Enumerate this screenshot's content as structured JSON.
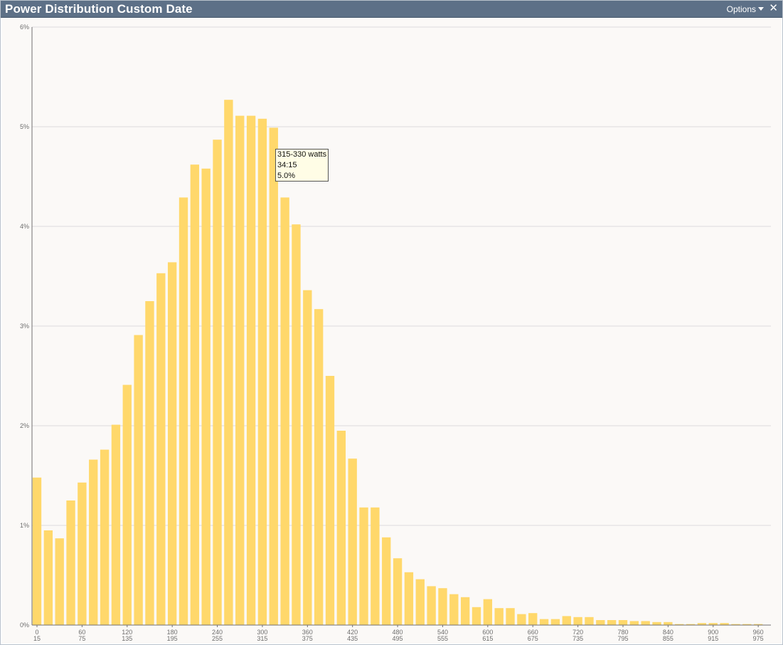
{
  "window": {
    "title": "Power Distribution Custom Date",
    "options_label": "Options",
    "close_symbol": "✕",
    "icons": {
      "options": "chevron-down-icon",
      "close": "close-icon"
    }
  },
  "colors": {
    "bar": "#ffd86b",
    "grid": "#dcdcdc",
    "axis": "#707070",
    "titlebar": "#5d7087",
    "background": "#fbf9f7"
  },
  "chart_data": {
    "type": "bar",
    "title": "Power Distribution Custom Date",
    "xlabel": "",
    "ylabel": "",
    "bin_width": 15,
    "bin_starts": [
      0,
      15,
      30,
      45,
      60,
      75,
      90,
      105,
      120,
      135,
      150,
      165,
      180,
      195,
      210,
      225,
      240,
      255,
      270,
      285,
      300,
      315,
      330,
      345,
      360,
      375,
      390,
      405,
      420,
      435,
      450,
      465,
      480,
      495,
      510,
      525,
      540,
      555,
      570,
      585,
      600,
      615,
      630,
      645,
      660,
      675,
      690,
      705,
      720,
      735,
      750,
      765,
      780,
      795,
      810,
      825,
      840,
      855,
      870,
      885,
      900,
      915,
      930,
      945,
      960
    ],
    "values": [
      1.48,
      0.95,
      0.87,
      1.25,
      1.43,
      1.66,
      1.76,
      2.01,
      2.41,
      2.91,
      3.25,
      3.53,
      3.64,
      4.29,
      4.62,
      4.58,
      4.87,
      5.27,
      5.11,
      5.11,
      5.08,
      4.99,
      4.29,
      4.02,
      3.36,
      3.17,
      2.5,
      1.95,
      1.67,
      1.18,
      1.18,
      0.88,
      0.67,
      0.53,
      0.46,
      0.39,
      0.37,
      0.31,
      0.28,
      0.18,
      0.26,
      0.17,
      0.17,
      0.11,
      0.12,
      0.06,
      0.06,
      0.09,
      0.08,
      0.08,
      0.05,
      0.05,
      0.05,
      0.04,
      0.04,
      0.03,
      0.03,
      0.01,
      0.01,
      0.02,
      0.02,
      0.02,
      0.01,
      0.01,
      0.01
    ],
    "y_unit": "%",
    "ylim": [
      0,
      6
    ],
    "yticks": [
      "0%",
      "1%",
      "2%",
      "3%",
      "4%",
      "5%",
      "6%"
    ],
    "xtick_top": [
      "0",
      "60",
      "120",
      "180",
      "240",
      "300",
      "360",
      "420",
      "480",
      "540",
      "600",
      "660",
      "720",
      "780",
      "840",
      "900",
      "960"
    ],
    "xtick_bottom": [
      "15",
      "75",
      "135",
      "195",
      "255",
      "315",
      "375",
      "435",
      "495",
      "555",
      "615",
      "675",
      "735",
      "795",
      "855",
      "915",
      "975"
    ],
    "grid": true,
    "legend": "none",
    "tooltip": {
      "range": "315-330 watts",
      "time": "34:15",
      "percent": "5.0%"
    }
  }
}
